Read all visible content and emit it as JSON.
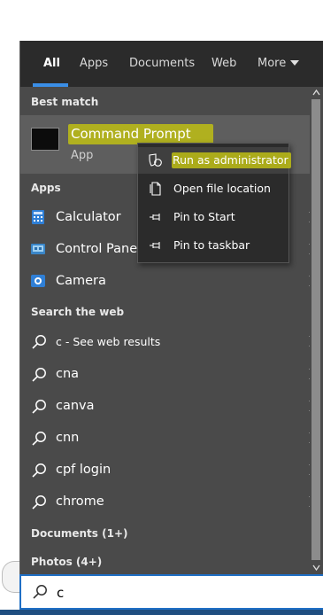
{
  "tabs": [
    {
      "label": "All"
    },
    {
      "label": "Apps"
    },
    {
      "label": "Documents"
    },
    {
      "label": "Web"
    },
    {
      "label": "More"
    }
  ],
  "sections": {
    "best_match": "Best match",
    "apps": "Apps",
    "search_web": "Search the web",
    "documents": "Documents (1+)",
    "photos": "Photos (4+)"
  },
  "best_match": {
    "title": "Command Prompt",
    "subtitle": "App"
  },
  "apps": [
    {
      "label": "Calculator",
      "icon": "calculator-icon"
    },
    {
      "label": "Control Panel",
      "icon": "control-panel-icon"
    },
    {
      "label": "Camera",
      "icon": "camera-icon"
    }
  ],
  "web_results": [
    {
      "label": "c - See web results"
    },
    {
      "label": "cna"
    },
    {
      "label": "canva"
    },
    {
      "label": "cnn"
    },
    {
      "label": "cpf login"
    },
    {
      "label": "chrome"
    }
  ],
  "context_menu": [
    {
      "label": "Run as administrator",
      "icon": "shield-icon"
    },
    {
      "label": "Open file location",
      "icon": "file-location-icon"
    },
    {
      "label": "Pin to Start",
      "icon": "pin-icon"
    },
    {
      "label": "Pin to taskbar",
      "icon": "pin-icon"
    }
  ],
  "search": {
    "value": "c"
  },
  "colors": {
    "panel": "#4a4a4a",
    "tabs_bar": "#2b2b2b",
    "accent": "#3a8ee6",
    "highlight": "#bebe14"
  }
}
